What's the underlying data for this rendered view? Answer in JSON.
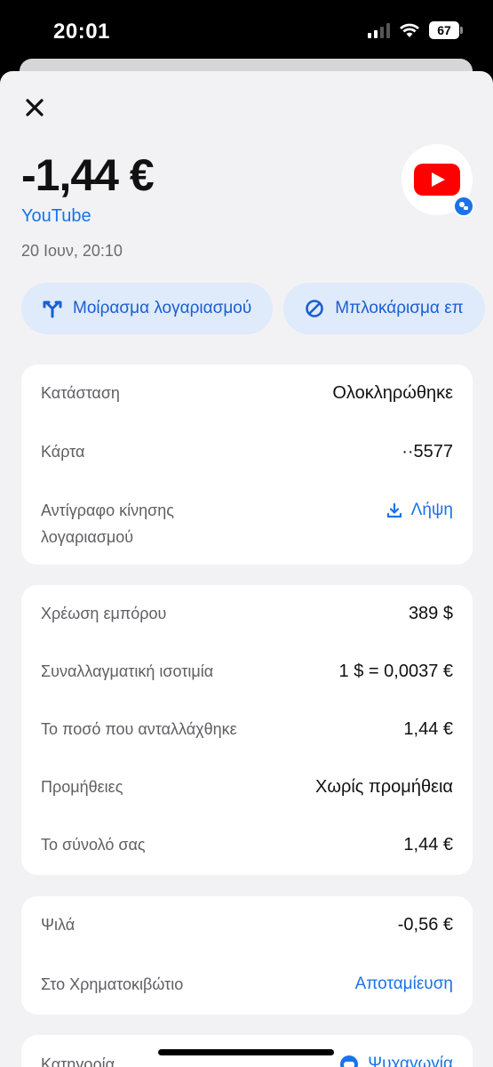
{
  "status": {
    "time": "20:01",
    "battery": "67"
  },
  "header": {
    "amount": "-1,44 €",
    "merchant": "YouTube",
    "date": "20 Ιουν, 20:10"
  },
  "actions": [
    {
      "label": "Μοίρασμα λογαριασμού",
      "icon": "split-icon"
    },
    {
      "label": "Μπλοκάρισμα επ",
      "icon": "block-icon"
    }
  ],
  "details": {
    "status_label": "Κατάσταση",
    "status_value": "Ολοκληρώθηκε",
    "card_label": "Κάρτα",
    "card_value": "··5577",
    "statement_label_1": "Αντίγραφο κίνησης",
    "statement_label_2": "λογαριασμού",
    "statement_action": "Λήψη"
  },
  "exchange": {
    "merchant_charge_label": "Χρέωση εμπόρου",
    "merchant_charge_value": "389 $",
    "rate_label": "Συναλλαγματική ισοτιμία",
    "rate_value": "1 $ = 0,0037 €",
    "exchanged_label": "Το ποσό που ανταλλάχθηκε",
    "exchanged_value": "1,44 €",
    "fees_label": "Προμήθειες",
    "fees_value": "Χωρίς προμήθεια",
    "total_label": "Το σύνολό σας",
    "total_value": "1,44 €"
  },
  "roundup": {
    "change_label": "Ψιλά",
    "change_value": "-0,56 €",
    "vault_label": "Στο Χρηματοκιβώτιο",
    "vault_action": "Αποταμίευση"
  },
  "category": {
    "label": "Κατηγορία",
    "value": "Ψυχαγωγία"
  },
  "colors": {
    "accent": "#1a73e8",
    "chip_bg": "#dfeafb",
    "youtube": "#ff0000",
    "background": "#f2f2f4"
  }
}
